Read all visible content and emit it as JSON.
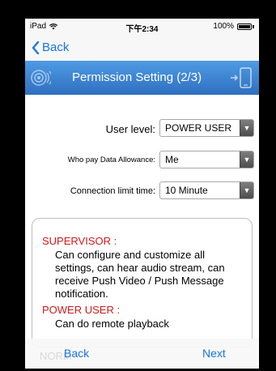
{
  "status_bar": {
    "device": "iPad",
    "time": "下午2:34",
    "battery": "100%"
  },
  "nav": {
    "back_label": "Back"
  },
  "banner": {
    "title": "Permission Setting (2/3)"
  },
  "form": {
    "user_level": {
      "label": "User level:",
      "value": "POWER USER"
    },
    "data_allowance": {
      "label": "Who pay Data Allowance:",
      "value": "Me"
    },
    "connection_limit": {
      "label": "Connection limit time:",
      "value": "10 Minute"
    }
  },
  "roles": [
    {
      "title": "SUPERVISOR :",
      "description": "Can configure and customize all settings, can hear audio stream, can receive Push Video / Push Message notification."
    },
    {
      "title": "POWER USER :",
      "description": "Can do remote playback"
    }
  ],
  "bottom": {
    "back_label": "Back",
    "next_label": "Next",
    "ghost": "NORM"
  },
  "colors": {
    "accent": "#1a73e8",
    "banner_top": "#4f9be4",
    "banner_bottom": "#2f6fc0",
    "role_title": "#d11a1a"
  }
}
